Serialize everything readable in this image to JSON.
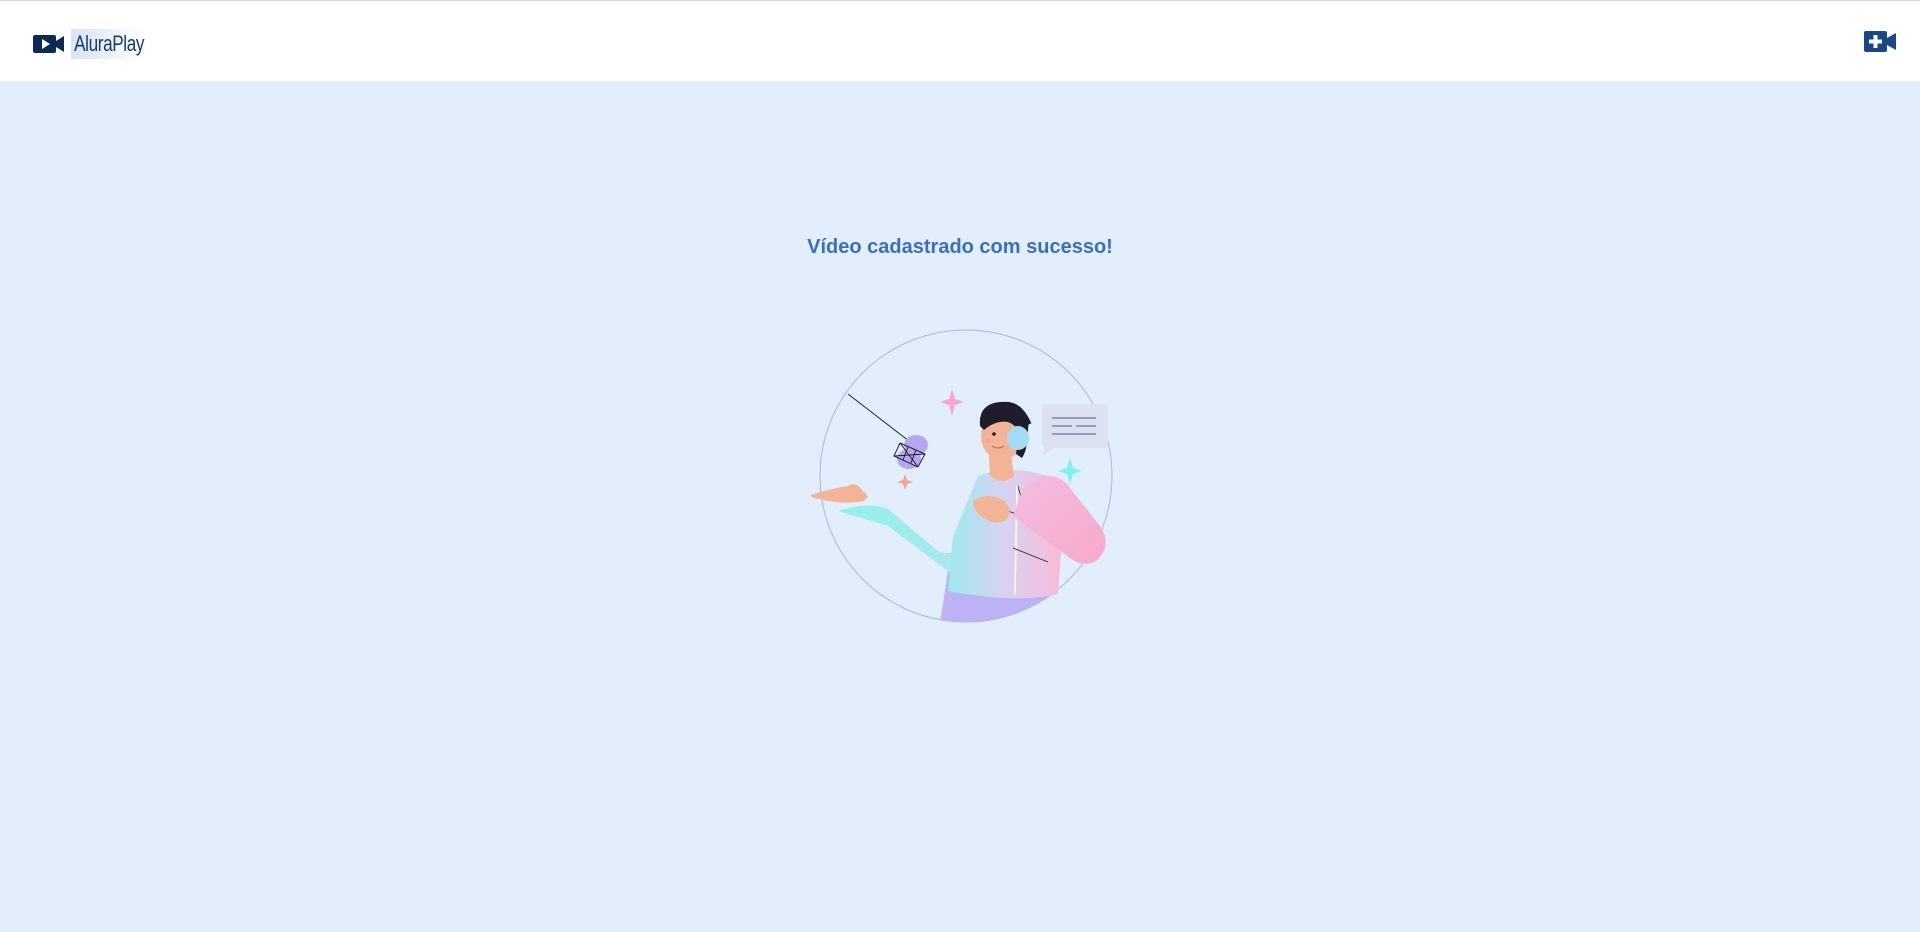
{
  "header": {
    "brand": "AluraPlay",
    "logo_icon": "video-camera-icon",
    "add_icon": "video-camera-plus-icon"
  },
  "main": {
    "message": "Vídeo cadastrado com sucesso!",
    "illustration": "person-with-headset-podcast-illustration"
  },
  "colors": {
    "background": "#e3eefc",
    "header_bg": "#ffffff",
    "brand_dark": "#1b3a6b",
    "message": "#3b6fb6"
  }
}
